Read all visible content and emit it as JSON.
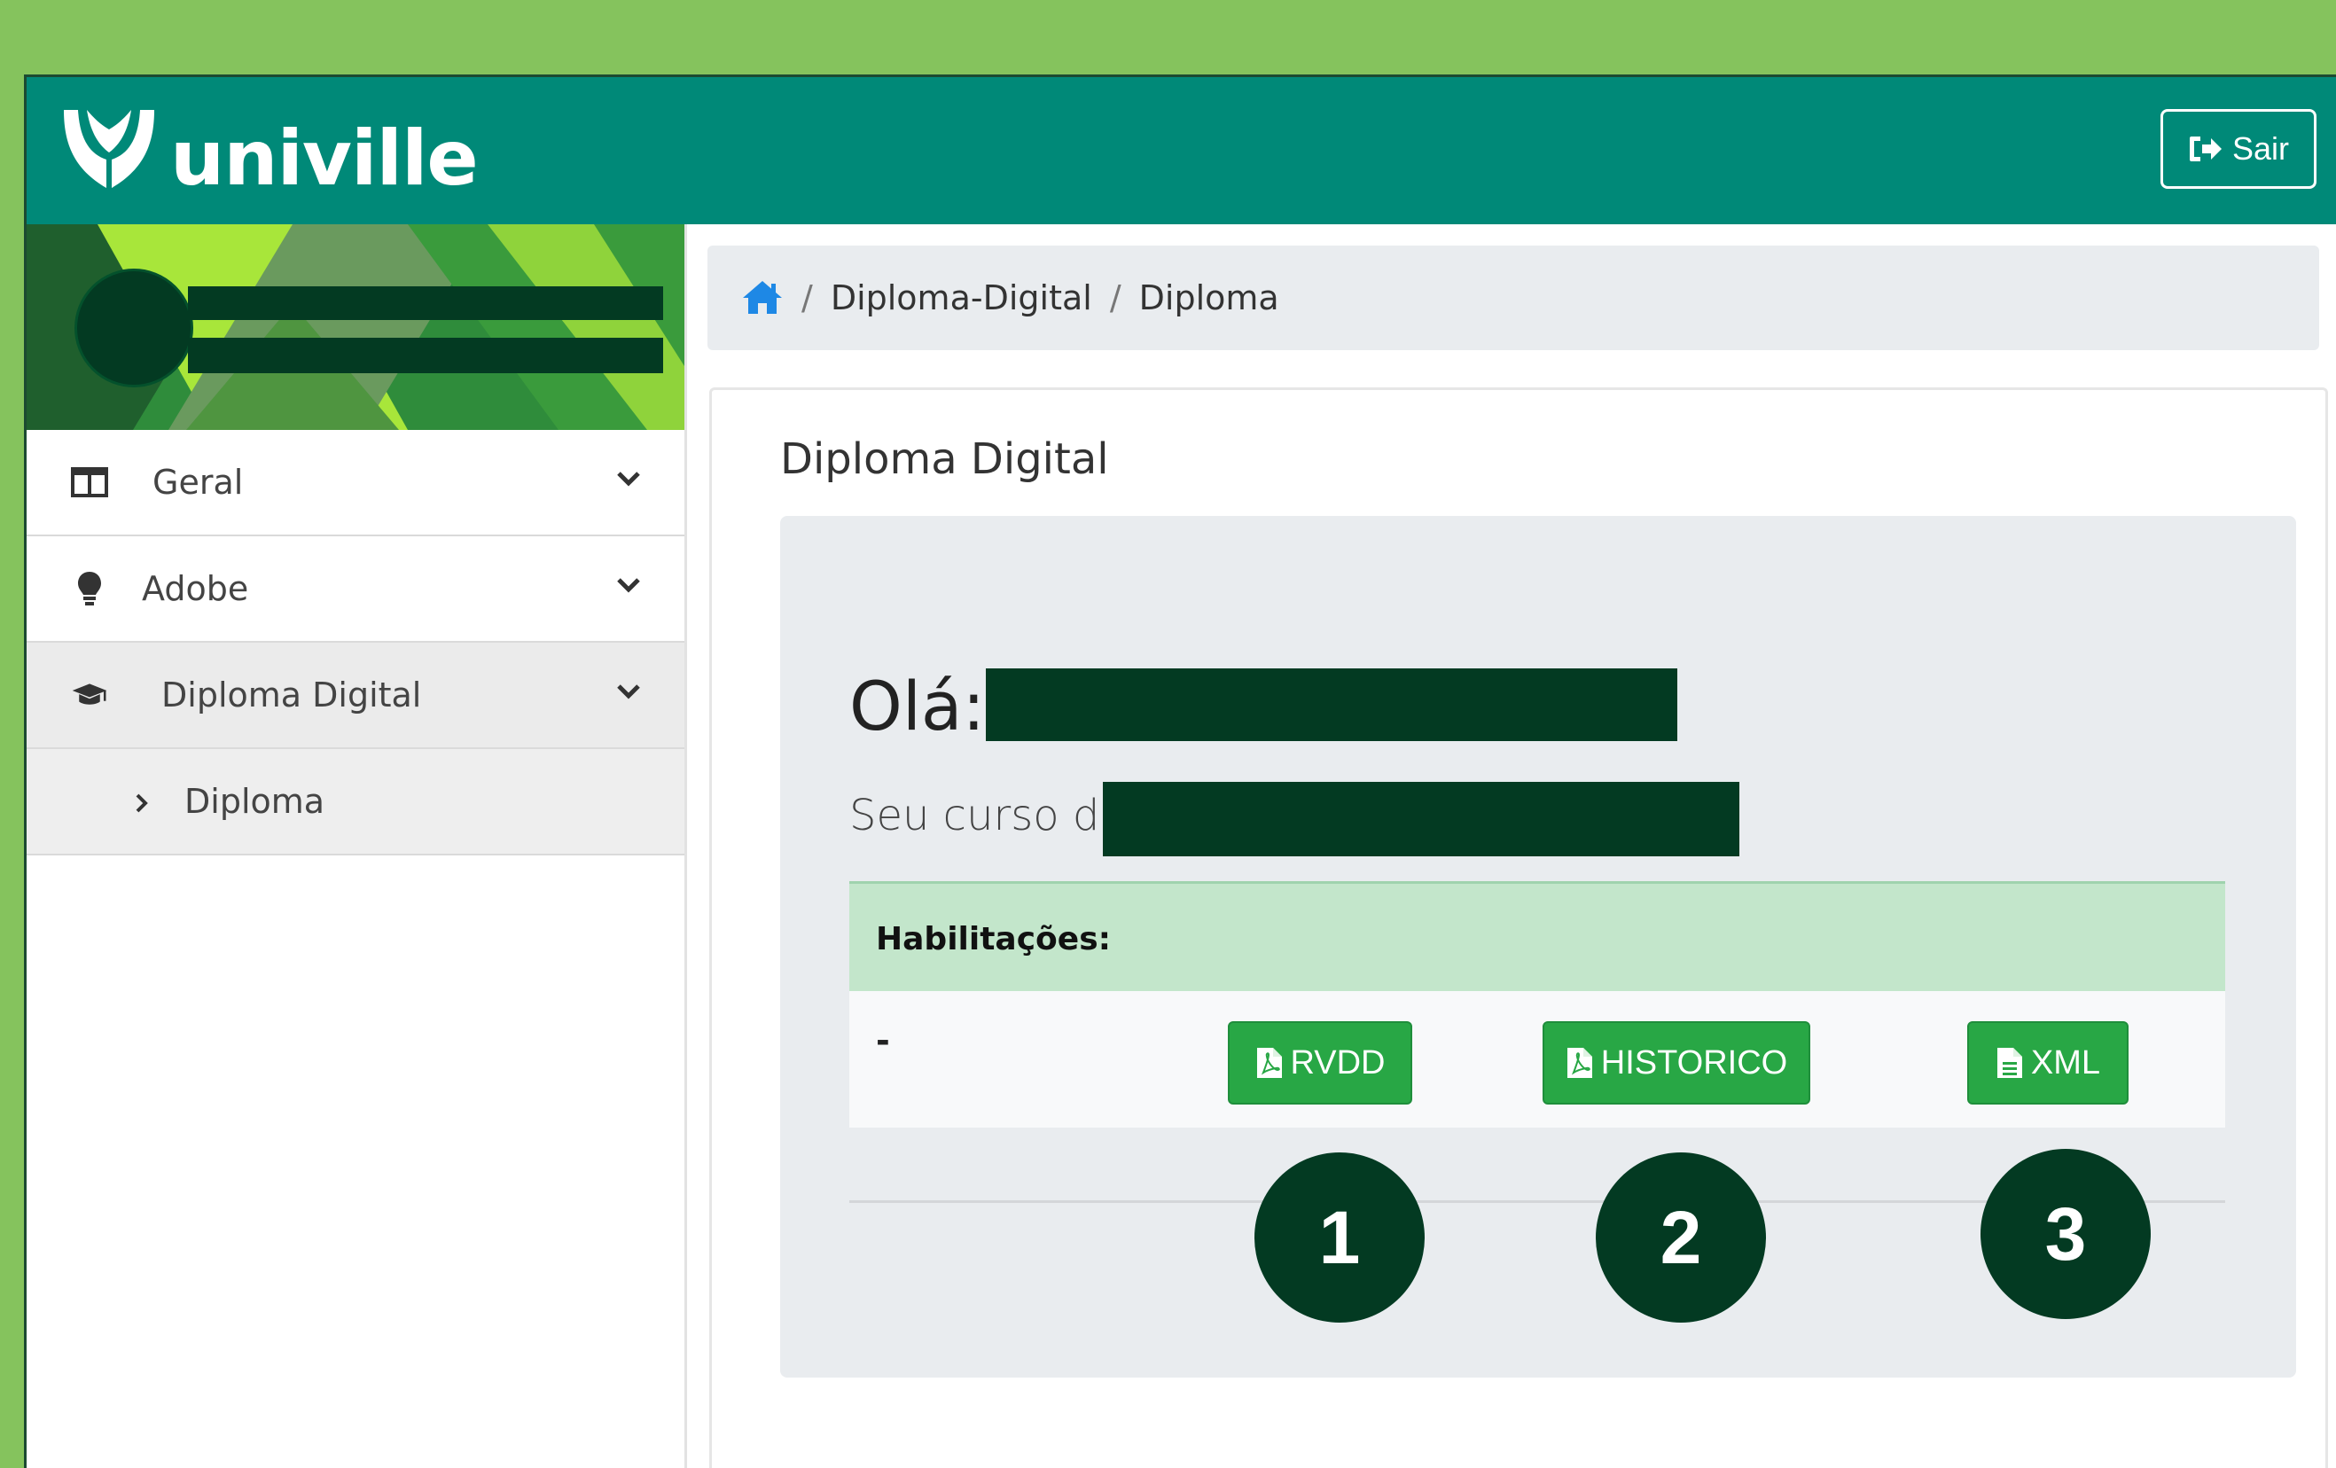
{
  "header": {
    "logo_text": "univille",
    "logout_label": "Sair"
  },
  "sidebar": {
    "items": [
      {
        "label": "Geral",
        "icon": "columns-icon"
      },
      {
        "label": "Adobe",
        "icon": "lightbulb-icon"
      },
      {
        "label": "Diploma Digital",
        "icon": "graduation-cap-icon"
      }
    ],
    "subitems": [
      {
        "label": "Diploma"
      }
    ]
  },
  "breadcrumb": {
    "items": [
      "Diploma-Digital",
      "Diploma"
    ]
  },
  "main": {
    "card_title": "Diploma Digital",
    "greeting": "Olá:",
    "course_label": "Seu curso de:",
    "habilitacoes_label": "Habilitações:",
    "habilitacao_value": "-",
    "buttons": [
      "RVDD",
      "HISTORICO",
      "XML"
    ],
    "callouts": [
      "1",
      "2",
      "3"
    ]
  },
  "colors": {
    "outer_bg": "#85c35d",
    "header_bg": "#008978",
    "button_green": "#28a745",
    "habilitacoes_bg": "#c3e6cb",
    "dark_green": "#033a22",
    "breadcrumb_home": "#1e88e5"
  }
}
